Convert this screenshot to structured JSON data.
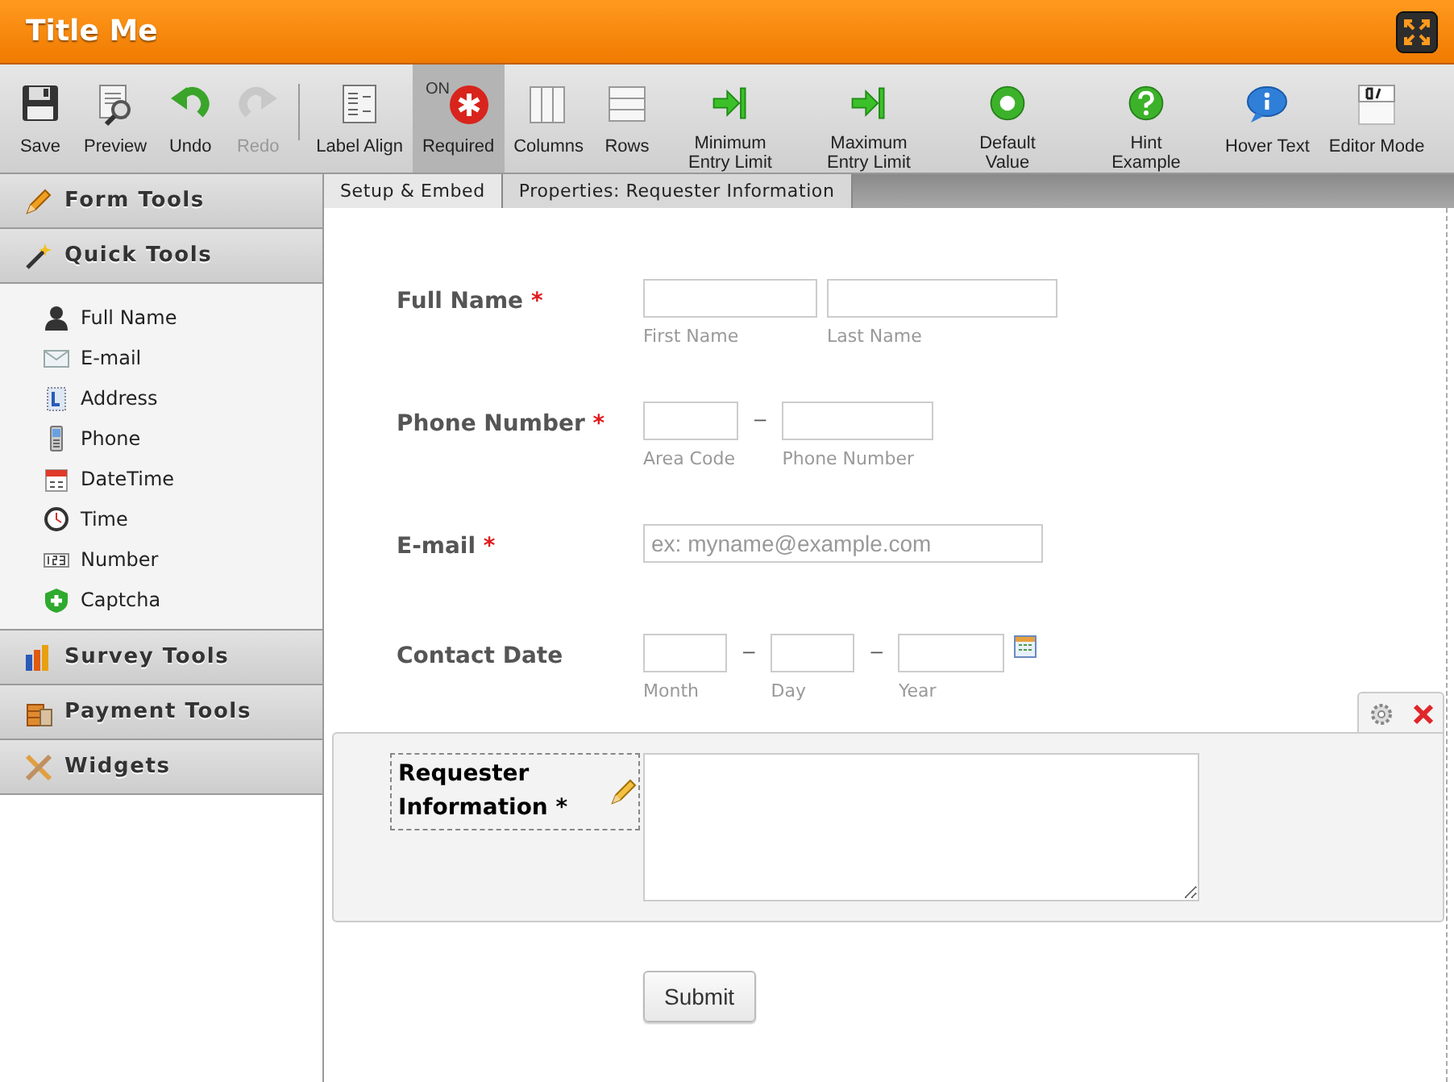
{
  "window": {
    "title": "Title Me"
  },
  "toolbar": {
    "groups": [
      [
        {
          "label": "Save",
          "selected": false,
          "disabled": false
        },
        {
          "label": "Preview",
          "selected": false,
          "disabled": false
        },
        {
          "label": "Undo",
          "selected": false,
          "disabled": false
        },
        {
          "label": "Redo",
          "selected": false,
          "disabled": true
        }
      ],
      [
        {
          "label": "Label Align",
          "selected": false,
          "disabled": false
        },
        {
          "label": "Required",
          "badge": "ON",
          "selected": true,
          "disabled": false
        },
        {
          "label": "Columns",
          "selected": false,
          "disabled": false
        },
        {
          "label": "Rows",
          "selected": false,
          "disabled": false
        },
        {
          "label": "Minimum Entry Limit",
          "selected": false,
          "disabled": false
        },
        {
          "label": "Maximum Entry Limit",
          "selected": false,
          "disabled": false
        },
        {
          "label": "Default Value",
          "selected": false,
          "disabled": false
        },
        {
          "label": "Hint Example",
          "selected": false,
          "disabled": false
        },
        {
          "label": "Hover Text",
          "selected": false,
          "disabled": false
        },
        {
          "label": "Editor Mode",
          "selected": false,
          "disabled": false
        }
      ]
    ]
  },
  "sidebar": {
    "sections": [
      {
        "title": "Form Tools",
        "expanded": false
      },
      {
        "title": "Quick Tools",
        "expanded": true,
        "items": [
          "Full Name",
          "E-mail",
          "Address",
          "Phone",
          "DateTime",
          "Time",
          "Number",
          "Captcha"
        ]
      },
      {
        "title": "Survey Tools",
        "expanded": false
      },
      {
        "title": "Payment Tools",
        "expanded": false
      },
      {
        "title": "Widgets",
        "expanded": false
      }
    ]
  },
  "tabs": [
    {
      "label": "Setup & Embed",
      "selected": true
    },
    {
      "label": "Properties: Requester Information",
      "selected": false
    }
  ],
  "form": {
    "fields": [
      {
        "kind": "name",
        "label": "Full Name",
        "required_mark": "*",
        "selected": false,
        "inputs": [
          {
            "sublabel": "First Name"
          },
          {
            "sublabel": "Last Name"
          }
        ]
      },
      {
        "kind": "phone",
        "label": "Phone Number",
        "required_mark": "*",
        "selected": false,
        "separator": "–",
        "inputs": [
          {
            "sublabel": "Area Code"
          },
          {
            "sublabel": "Phone Number"
          }
        ]
      },
      {
        "kind": "email",
        "label": "E-mail",
        "required_mark": "*",
        "selected": false,
        "placeholder": "ex: myname@example.com"
      },
      {
        "kind": "date",
        "label": "Contact Date",
        "selected": false,
        "separator": "–",
        "inputs": [
          {
            "sublabel": "Month"
          },
          {
            "sublabel": "Day"
          },
          {
            "sublabel": "Year"
          }
        ]
      },
      {
        "kind": "textarea",
        "label": "Requester Information",
        "required_mark": "*",
        "selected": true
      }
    ],
    "submit": "Submit"
  }
}
